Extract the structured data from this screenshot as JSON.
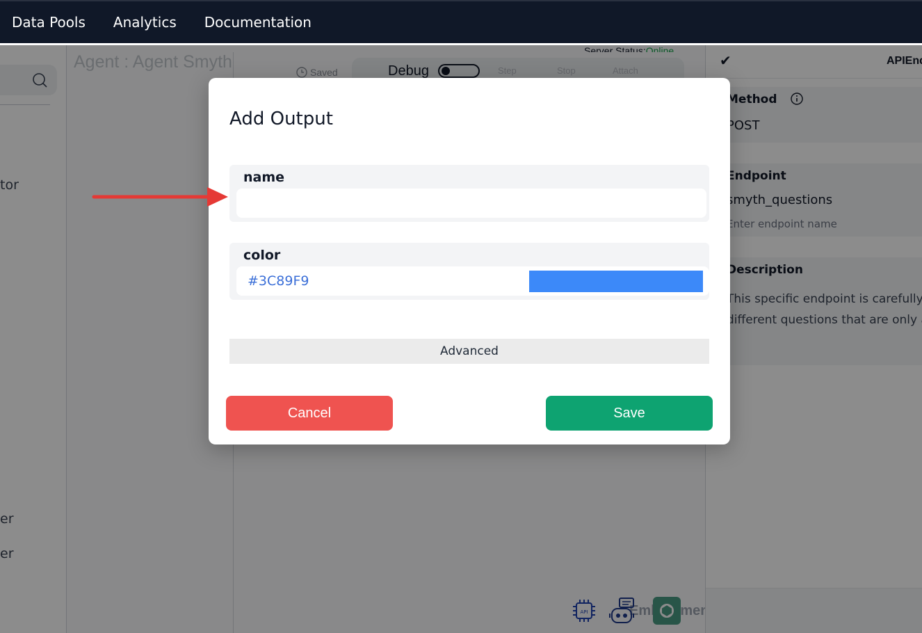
{
  "nav": {
    "items": [
      {
        "label": "Data Pools"
      },
      {
        "label": "Analytics"
      },
      {
        "label": "Documentation"
      }
    ]
  },
  "sidebar": {
    "search_icon": "search-icon",
    "items": [
      {
        "label": "tor"
      },
      {
        "label": "er"
      },
      {
        "label": "er"
      }
    ]
  },
  "canvas": {
    "agent_title": "Agent : Agent Smyth",
    "server_status_label": "Server Status:",
    "server_status_value": "Online",
    "saved_label": "Saved",
    "debug_label": "Debug",
    "toolbar_ghost": [
      "Step",
      "Stop",
      "Attach"
    ],
    "embodiments_label": "Embodiments",
    "embodiment_icons": [
      "api-chip-icon",
      "chatbot-icon",
      "openai-icon"
    ]
  },
  "right_panel": {
    "title": "APIEnd",
    "method_label": "Method",
    "method_value": "POST",
    "endpoint_label": "Endpoint",
    "endpoint_value": "smyth_questions",
    "endpoint_hint": "Enter endpoint name",
    "description_label": "Description",
    "description_lines": [
      "This specific endpoint is carefully r",
      "different questions that are only ab"
    ]
  },
  "modal": {
    "title": "Add Output",
    "name_label": "name",
    "name_value": "",
    "color_label": "color",
    "color_value": "#3C89F9",
    "advanced_label": "Advanced",
    "cancel_label": "Cancel",
    "save_label": "Save"
  },
  "colors": {
    "swatch": "#3C89F9",
    "cancel": "#EF5350",
    "save": "#0EA371",
    "annotation_arrow": "#E53935"
  }
}
